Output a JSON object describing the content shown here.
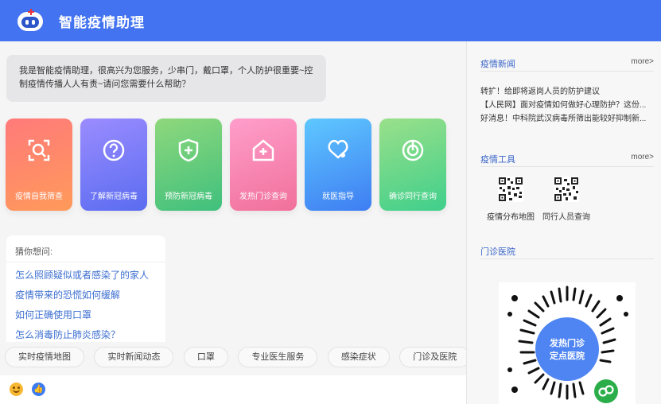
{
  "header": {
    "title": "智能疫情助理"
  },
  "chat": {
    "greeting": "我是智能疫情助理，很高兴为您服务，少串门，戴口罩，个人防护很重要~控制疫情传播人人有责~请问您需要什么帮助？",
    "cards": [
      {
        "label": "疫情自我筛查",
        "icon": "scan-search-icon"
      },
      {
        "label": "了解新冠病毒",
        "icon": "question-icon"
      },
      {
        "label": "预防新冠病毒",
        "icon": "shield-plus-icon"
      },
      {
        "label": "发热门诊查询",
        "icon": "hospital-icon"
      },
      {
        "label": "就医指导",
        "icon": "stethoscope-icon"
      },
      {
        "label": "确诊同行查询",
        "icon": "target-icon"
      }
    ],
    "suggestions": {
      "title": "猜你想问:",
      "items": [
        "怎么照顾疑似或者感染了的家人",
        "疫情带来的恐慌如何缓解",
        "如何正确使用口罩",
        "怎么消毒防止肺炎感染？"
      ]
    },
    "chips": [
      "实时疫情地图",
      "实时新闻动态",
      "口罩",
      "专业医生服务",
      "感染症状",
      "门诊及医院"
    ],
    "input": {
      "emoji_icon": "emoji-icon",
      "like_icon": "thumbs-up-icon",
      "like_glyph": "👍"
    }
  },
  "sidebar": {
    "news": {
      "title": "疫情新闻",
      "more": "more>",
      "items": [
        "转扩！给即将返岗人员的防护建议",
        "【人民网】面对疫情如何做好心理防护？这份...",
        "好消息！中科院武汉病毒所筛出能较好抑制新..."
      ],
      "carousel_pages": 2
    },
    "tools": {
      "title": "疫情工具",
      "more": "more>",
      "items": [
        {
          "label": "疫情分布地图"
        },
        {
          "label": "同行人员查询"
        }
      ]
    },
    "clinic": {
      "title": "门诊医院",
      "poster_line1": "发热门诊",
      "poster_line2": "定点医院"
    }
  },
  "colors": {
    "header": "#4373f1",
    "link": "#3d6fd1",
    "card_gradients": [
      [
        "#ff7a7a",
        "#ff9a5a"
      ],
      [
        "#9b8cff",
        "#5a6cf0"
      ],
      [
        "#8fd87c",
        "#3fc07d"
      ],
      [
        "#ff9ecb",
        "#f0709a"
      ],
      [
        "#5fc8ff",
        "#3e7df2"
      ],
      [
        "#9ae08a",
        "#3fcf8b"
      ]
    ]
  }
}
